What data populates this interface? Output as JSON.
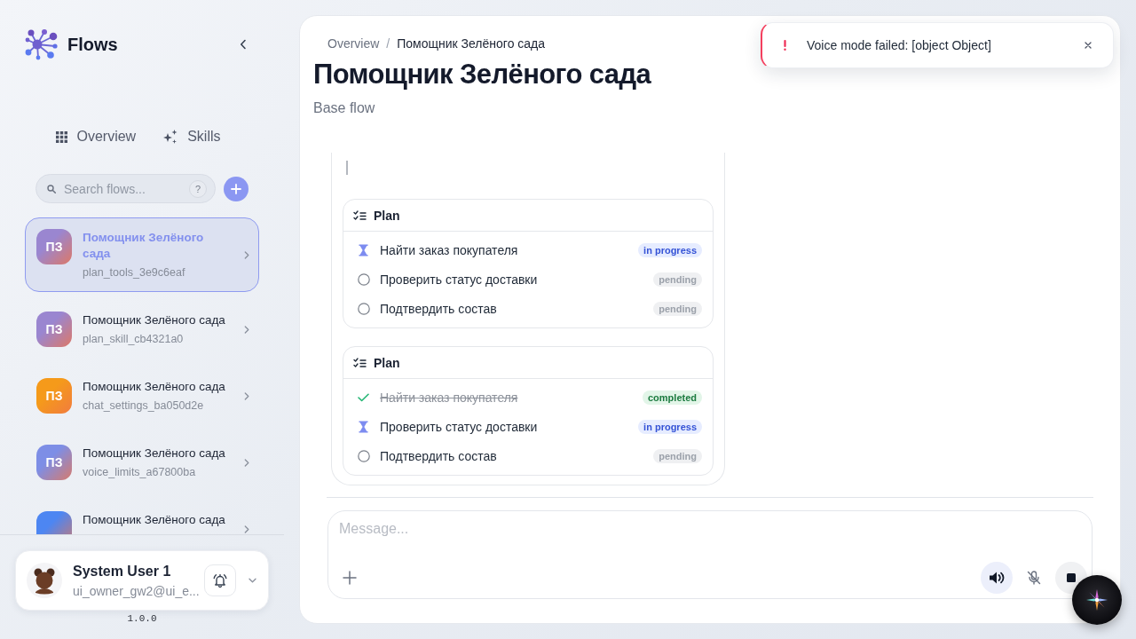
{
  "sidebar": {
    "brand": "Flows",
    "nav": [
      {
        "label": "Overview"
      },
      {
        "label": "Skills"
      }
    ],
    "search": {
      "placeholder": "Search flows...",
      "help": "?"
    },
    "flows": [
      {
        "initials": "ПЗ",
        "title": "Помощник Зелёного сада",
        "subtitle": "plan_tools_3e9c6eaf",
        "color": "#9a86d0",
        "selected": true
      },
      {
        "initials": "ПЗ",
        "title": "Помощник Зелёного сада",
        "subtitle": "plan_skill_cb4321a0",
        "color": "#9a86d0",
        "selected": false
      },
      {
        "initials": "ПЗ",
        "title": "Помощник Зелёного сада",
        "subtitle": "chat_settings_ba050d2e",
        "color": "#f59a1a",
        "selected": false
      },
      {
        "initials": "ПЗ",
        "title": "Помощник Зелёного сада",
        "subtitle": "voice_limits_a67800ba",
        "color": "#7d8ee6",
        "selected": false
      },
      {
        "title": "Помощник Зелёного сада",
        "color": "#4d86f2",
        "selected": false
      }
    ],
    "user": {
      "name": "System User 1",
      "email": "ui_owner_gw2@ui_e..."
    },
    "version": "1.0.0"
  },
  "main": {
    "breadcrumb": {
      "items": [
        "Overview",
        "Помощник Зелёного сада"
      ],
      "separator": "/"
    },
    "title": "Помощник Зелёного сада",
    "subtitle": "Base flow",
    "plans": [
      {
        "title": "Plan",
        "steps": [
          {
            "text": "Найти заказ покупателя",
            "kind": "in_progress",
            "badge": "in progress"
          },
          {
            "text": "Проверить статус доставки",
            "kind": "pending",
            "badge": "pending"
          },
          {
            "text": "Подтвердить состав",
            "kind": "pending",
            "badge": "pending"
          }
        ]
      },
      {
        "title": "Plan",
        "steps": [
          {
            "text": "Найти заказ покупателя",
            "kind": "completed",
            "badge": "completed"
          },
          {
            "text": "Проверить статус доставки",
            "kind": "in_progress",
            "badge": "in progress"
          },
          {
            "text": "Подтвердить состав",
            "kind": "pending",
            "badge": "pending"
          }
        ]
      }
    ],
    "composer": {
      "placeholder": "Message...",
      "speaker_on": true,
      "mic_muted": true
    }
  },
  "toast": {
    "kind": "error",
    "message": "Voice mode failed: [object Object]"
  }
}
